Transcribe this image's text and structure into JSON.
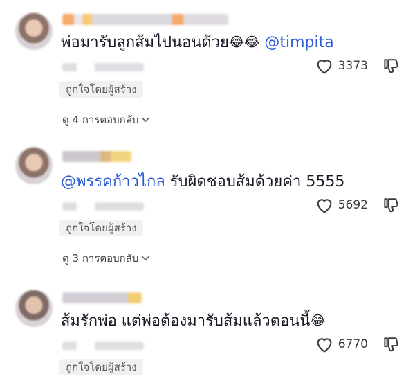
{
  "comments": [
    {
      "text": "พ่อมารับลูกส้มไปนอนด้วย",
      "emojis": "😂😂",
      "mention": "@timpita",
      "likes": "3373",
      "creator_badge": "ถูกใจโดยผู้สร้าง",
      "replies": "ดู 4 การตอบกลับ"
    },
    {
      "mention": "@พรรคก้าวไกล",
      "text": " รับผิดชอบส้มด้วยค่า 5555",
      "likes": "5692",
      "creator_badge": "ถูกใจโดยผู้สร้าง",
      "replies": "ดู 3 การตอบกลับ"
    },
    {
      "text": "ส้มรักพ่อ แต่พ่อต้องมารับส้มแล้วตอนนี้",
      "emojis": "😂",
      "likes": "6770",
      "creator_badge": "ถูกใจโดยผู้สร้าง"
    }
  ],
  "icons": {
    "like": "heart-outline-icon",
    "dislike": "thumbs-down-outline-icon",
    "chevron": "chevron-down-icon"
  }
}
